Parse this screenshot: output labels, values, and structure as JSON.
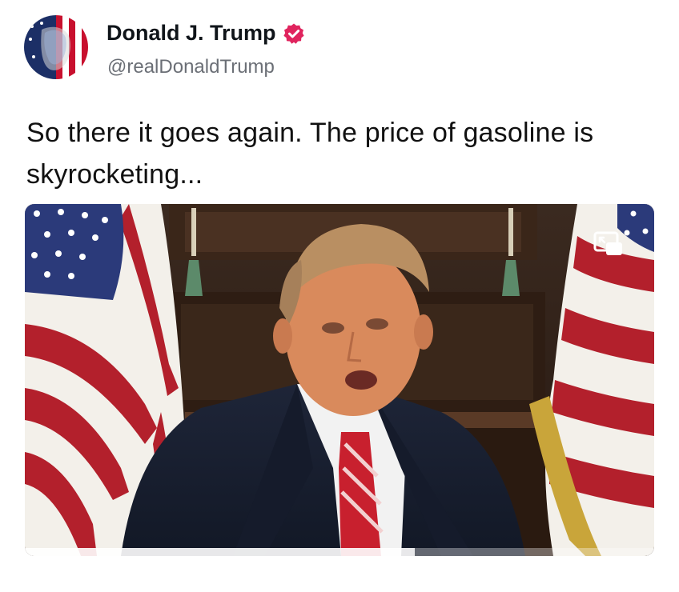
{
  "post": {
    "author": {
      "name": "Donald J. Trump",
      "handle": "@realDonaldTrump",
      "verified_color": "#e0245e"
    },
    "text": "So there it goes again. The price of gasoline is skyrocketing...",
    "media": {
      "type": "video",
      "pip_icon": "picture-in-picture-icon",
      "progress": 0.62
    }
  }
}
